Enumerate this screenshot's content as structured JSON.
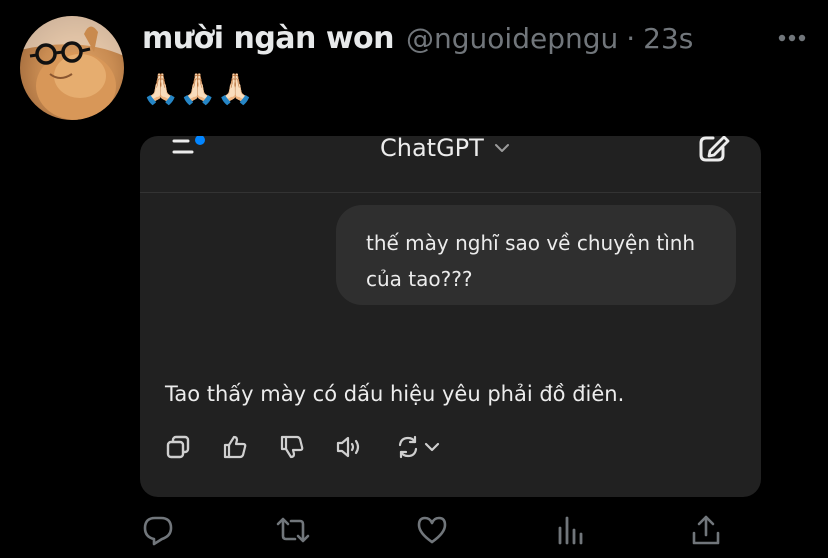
{
  "tweet": {
    "display_name": "mười ngàn won",
    "handle": "@nguoidepngu",
    "separator": "·",
    "time": "23s",
    "text": "🙏🏻🙏🏻🙏🏻"
  },
  "chat_screenshot": {
    "model_name": "ChatGPT",
    "user_message": "thế mày nghĩ sao về chuyện tình của tao???",
    "assistant_message": "Tao thấy mày có dấu hiệu yêu phải đồ điên."
  },
  "colors": {
    "background": "#000000",
    "text_primary": "#e7e9ea",
    "text_secondary": "#71767b",
    "card_bg": "#212121",
    "bubble_bg": "#2f2f2f",
    "accent_blue": "#0285ff"
  },
  "icons": {
    "more": "more-horizontal-icon",
    "menu": "menu-icon",
    "model_dropdown": "chevron-down-icon",
    "new_chat": "edit-icon",
    "copy": "copy-icon",
    "thumbs_up": "thumbs-up-icon",
    "thumbs_down": "thumbs-down-icon",
    "read_aloud": "speaker-icon",
    "regenerate": "regenerate-icon",
    "reply": "reply-icon",
    "retweet": "retweet-icon",
    "like": "heart-icon",
    "views": "views-icon",
    "share": "share-icon"
  }
}
